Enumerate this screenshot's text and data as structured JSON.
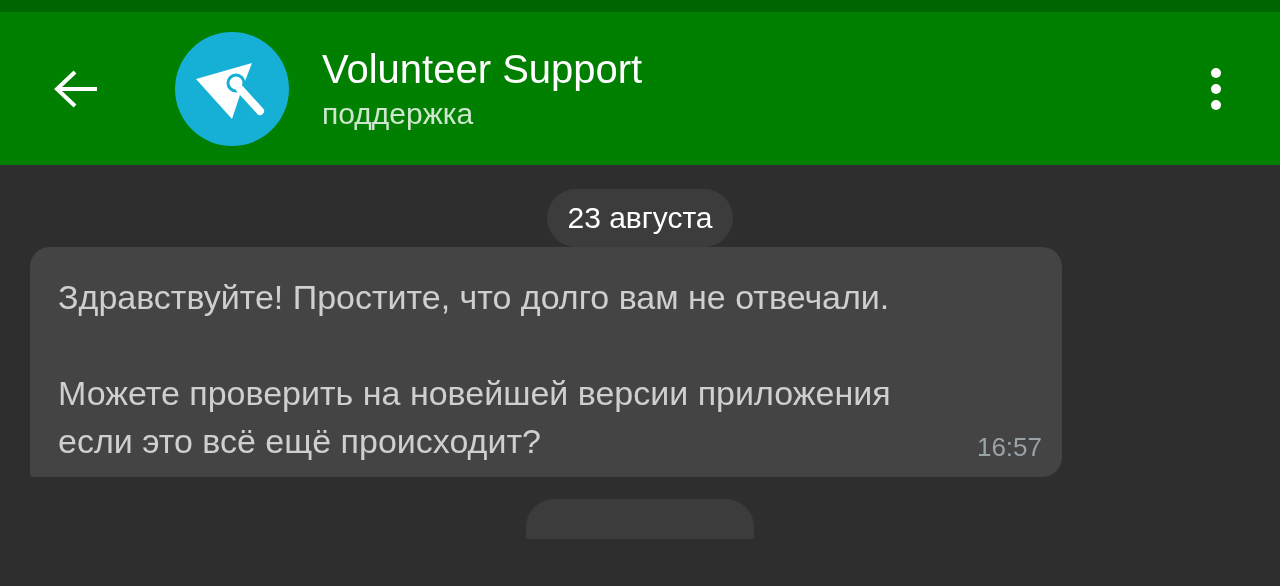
{
  "header": {
    "title": "Volunteer Support",
    "subtitle": "поддержка"
  },
  "messages": [
    {
      "kind": "date",
      "text": "23 августа"
    },
    {
      "kind": "incoming",
      "paragraphs": [
        "Здравствуйте! Простите, что долго вам не отвечали.",
        "Можете проверить на новейшей версии приложения если это всё ещё происходит?"
      ],
      "time": "16:57"
    },
    {
      "kind": "date-cut"
    }
  ]
}
